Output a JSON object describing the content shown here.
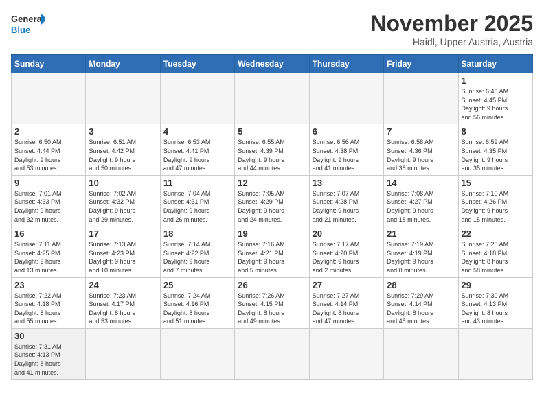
{
  "header": {
    "logo_general": "General",
    "logo_blue": "Blue",
    "month": "November 2025",
    "location": "Haidl, Upper Austria, Austria"
  },
  "days_of_week": [
    "Sunday",
    "Monday",
    "Tuesday",
    "Wednesday",
    "Thursday",
    "Friday",
    "Saturday"
  ],
  "weeks": [
    [
      {
        "day": "",
        "info": ""
      },
      {
        "day": "",
        "info": ""
      },
      {
        "day": "",
        "info": ""
      },
      {
        "day": "",
        "info": ""
      },
      {
        "day": "",
        "info": ""
      },
      {
        "day": "",
        "info": ""
      },
      {
        "day": "1",
        "info": "Sunrise: 6:48 AM\nSunset: 4:45 PM\nDaylight: 9 hours\nand 56 minutes."
      }
    ],
    [
      {
        "day": "2",
        "info": "Sunrise: 6:50 AM\nSunset: 4:44 PM\nDaylight: 9 hours\nand 53 minutes."
      },
      {
        "day": "3",
        "info": "Sunrise: 6:51 AM\nSunset: 4:42 PM\nDaylight: 9 hours\nand 50 minutes."
      },
      {
        "day": "4",
        "info": "Sunrise: 6:53 AM\nSunset: 4:41 PM\nDaylight: 9 hours\nand 47 minutes."
      },
      {
        "day": "5",
        "info": "Sunrise: 6:55 AM\nSunset: 4:39 PM\nDaylight: 9 hours\nand 44 minutes."
      },
      {
        "day": "6",
        "info": "Sunrise: 6:56 AM\nSunset: 4:38 PM\nDaylight: 9 hours\nand 41 minutes."
      },
      {
        "day": "7",
        "info": "Sunrise: 6:58 AM\nSunset: 4:36 PM\nDaylight: 9 hours\nand 38 minutes."
      },
      {
        "day": "8",
        "info": "Sunrise: 6:59 AM\nSunset: 4:35 PM\nDaylight: 9 hours\nand 35 minutes."
      }
    ],
    [
      {
        "day": "9",
        "info": "Sunrise: 7:01 AM\nSunset: 4:33 PM\nDaylight: 9 hours\nand 32 minutes."
      },
      {
        "day": "10",
        "info": "Sunrise: 7:02 AM\nSunset: 4:32 PM\nDaylight: 9 hours\nand 29 minutes."
      },
      {
        "day": "11",
        "info": "Sunrise: 7:04 AM\nSunset: 4:31 PM\nDaylight: 9 hours\nand 26 minutes."
      },
      {
        "day": "12",
        "info": "Sunrise: 7:05 AM\nSunset: 4:29 PM\nDaylight: 9 hours\nand 24 minutes."
      },
      {
        "day": "13",
        "info": "Sunrise: 7:07 AM\nSunset: 4:28 PM\nDaylight: 9 hours\nand 21 minutes."
      },
      {
        "day": "14",
        "info": "Sunrise: 7:08 AM\nSunset: 4:27 PM\nDaylight: 9 hours\nand 18 minutes."
      },
      {
        "day": "15",
        "info": "Sunrise: 7:10 AM\nSunset: 4:26 PM\nDaylight: 9 hours\nand 15 minutes."
      }
    ],
    [
      {
        "day": "16",
        "info": "Sunrise: 7:11 AM\nSunset: 4:25 PM\nDaylight: 9 hours\nand 13 minutes."
      },
      {
        "day": "17",
        "info": "Sunrise: 7:13 AM\nSunset: 4:23 PM\nDaylight: 9 hours\nand 10 minutes."
      },
      {
        "day": "18",
        "info": "Sunrise: 7:14 AM\nSunset: 4:22 PM\nDaylight: 9 hours\nand 7 minutes."
      },
      {
        "day": "19",
        "info": "Sunrise: 7:16 AM\nSunset: 4:21 PM\nDaylight: 9 hours\nand 5 minutes."
      },
      {
        "day": "20",
        "info": "Sunrise: 7:17 AM\nSunset: 4:20 PM\nDaylight: 9 hours\nand 2 minutes."
      },
      {
        "day": "21",
        "info": "Sunrise: 7:19 AM\nSunset: 4:19 PM\nDaylight: 9 hours\nand 0 minutes."
      },
      {
        "day": "22",
        "info": "Sunrise: 7:20 AM\nSunset: 4:18 PM\nDaylight: 8 hours\nand 58 minutes."
      }
    ],
    [
      {
        "day": "23",
        "info": "Sunrise: 7:22 AM\nSunset: 4:18 PM\nDaylight: 8 hours\nand 55 minutes."
      },
      {
        "day": "24",
        "info": "Sunrise: 7:23 AM\nSunset: 4:17 PM\nDaylight: 8 hours\nand 53 minutes."
      },
      {
        "day": "25",
        "info": "Sunrise: 7:24 AM\nSunset: 4:16 PM\nDaylight: 8 hours\nand 51 minutes."
      },
      {
        "day": "26",
        "info": "Sunrise: 7:26 AM\nSunset: 4:15 PM\nDaylight: 8 hours\nand 49 minutes."
      },
      {
        "day": "27",
        "info": "Sunrise: 7:27 AM\nSunset: 4:14 PM\nDaylight: 8 hours\nand 47 minutes."
      },
      {
        "day": "28",
        "info": "Sunrise: 7:29 AM\nSunset: 4:14 PM\nDaylight: 8 hours\nand 45 minutes."
      },
      {
        "day": "29",
        "info": "Sunrise: 7:30 AM\nSunset: 4:13 PM\nDaylight: 8 hours\nand 43 minutes."
      }
    ],
    [
      {
        "day": "30",
        "info": "Sunrise: 7:31 AM\nSunset: 4:13 PM\nDaylight: 8 hours\nand 41 minutes."
      },
      {
        "day": "",
        "info": ""
      },
      {
        "day": "",
        "info": ""
      },
      {
        "day": "",
        "info": ""
      },
      {
        "day": "",
        "info": ""
      },
      {
        "day": "",
        "info": ""
      },
      {
        "day": "",
        "info": ""
      }
    ]
  ]
}
